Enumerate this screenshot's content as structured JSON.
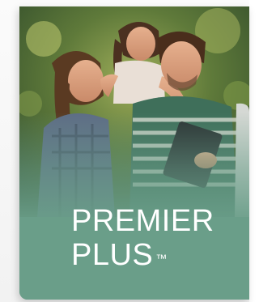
{
  "card": {
    "title_line1": "PREMIER",
    "title_line2": "PLUS",
    "trademark": "™",
    "accent_color": "#6a9e89"
  },
  "photo": {
    "subject": "family-photo"
  }
}
